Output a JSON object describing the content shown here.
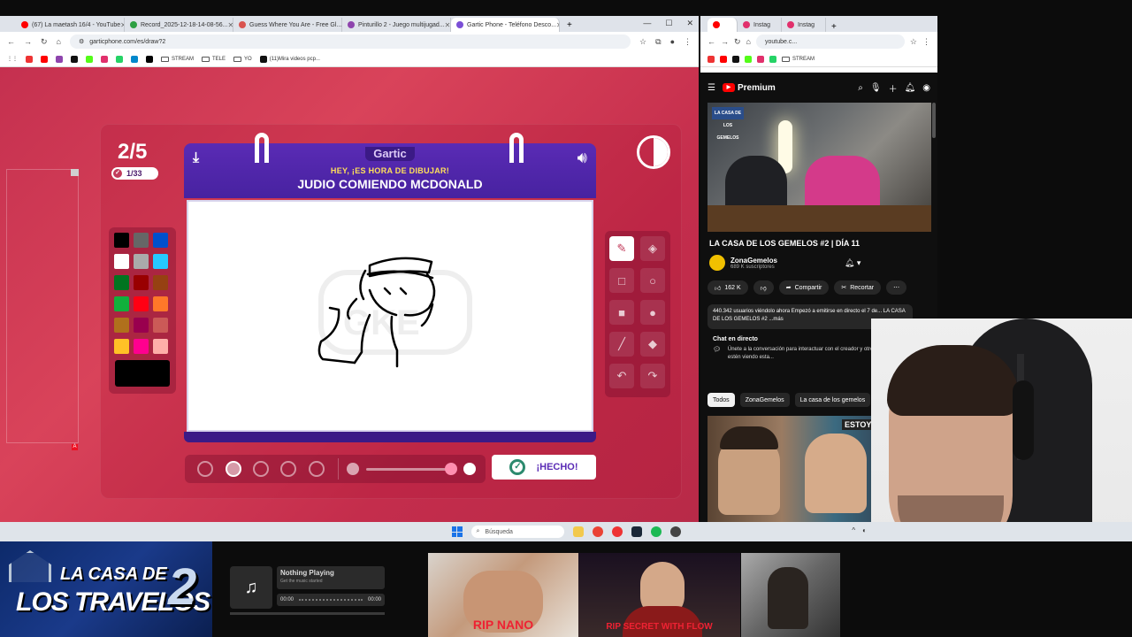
{
  "left_browser": {
    "tabs": [
      {
        "title": "(67) La maetash 16/4 - YouTube",
        "color": "#ff0000"
      },
      {
        "title": "Record_2025-12-18-14-08-56...",
        "color": "#2ea043"
      },
      {
        "title": "Guess Where You Are - Free Gl...",
        "color": "#d9534f"
      },
      {
        "title": "Pinturillo 2 - Juego multijugad...",
        "color": "#8e44ad"
      },
      {
        "title": "Gartic Phone - Teléfono Desco...",
        "color": "#7b4fd6"
      }
    ],
    "url": "garticphone.com/es/draw?2",
    "bookmarks": [
      "STREAM",
      "TELE",
      "YO",
      "(11)Mira videos pcp..."
    ]
  },
  "gartic": {
    "round": "2/5",
    "players": "1/33",
    "logo": "Gartic",
    "subtitle": "HEY, ¡ES HORA DE DIBUJAR!",
    "prompt": "JUDIO COMIENDO MCDONALD",
    "done_label": "¡HECHO!",
    "side_marker": "A",
    "palette": [
      "#000000",
      "#666666",
      "#0050cd",
      "#ffffff",
      "#aaaaaa",
      "#26c9ff",
      "#017420",
      "#990000",
      "#964112",
      "#11b03c",
      "#ff0013",
      "#ff7829",
      "#b0701c",
      "#99004e",
      "#cb5a57",
      "#ffc126",
      "#ff008f",
      "#feafa8"
    ],
    "selected_color": "#000000",
    "tools": [
      "pencil-icon",
      "eraser-icon",
      "rectangle-outline-icon",
      "circle-outline-icon",
      "rectangle-fill-icon",
      "circle-fill-icon",
      "line-icon",
      "bucket-icon",
      "undo-icon",
      "redo-icon"
    ],
    "brush_sizes": 5,
    "selected_brush": 2,
    "colors": {
      "bg": "#c5304f",
      "header": "#5a2bb5",
      "subtitle": "#ffe05a"
    }
  },
  "right_browser": {
    "tabs": [
      "Instag",
      "Instag"
    ],
    "url": "youtube.c...",
    "bookmark": "STREAM"
  },
  "youtube": {
    "brand": "Premium",
    "thumb_badge": "LA CASA DE LOS GEMELOS",
    "title": "LA CASA DE LOS GEMELOS #2 | DÍA 11",
    "channel": "ZonaGemelos",
    "subscribers": "689 K suscriptores",
    "likes": "162 K",
    "share": "Compartir",
    "clip": "Recortar",
    "description": "440.342 usuarios viéndolo ahora  Empezó a emitirse en directo el 7 de... LA CASA DE LOS GEMELOS #2 ...más",
    "chat_title": "Chat en directo",
    "chat_text": "Únete a la conversación para interactuar con el creador y otros usuarios que estén viendo esta...",
    "filters": [
      "Todos",
      "ZonaGemelos",
      "La casa de los gemelos"
    ],
    "rec_sign": "ESTOY"
  },
  "taskbar": {
    "search": "Búsqueda"
  },
  "overlay": {
    "logo_line1": "LA CASA DE",
    "logo_line2": "LOS TRAVELOS",
    "logo_number": "2",
    "music_title": "Nothing Playing",
    "music_sub": "Get the music started",
    "music_start": "00:00",
    "music_end": "00:00",
    "clip1_caption": "RIP NANO",
    "clip2_caption": "RIP SECRET WITH FLOW"
  }
}
